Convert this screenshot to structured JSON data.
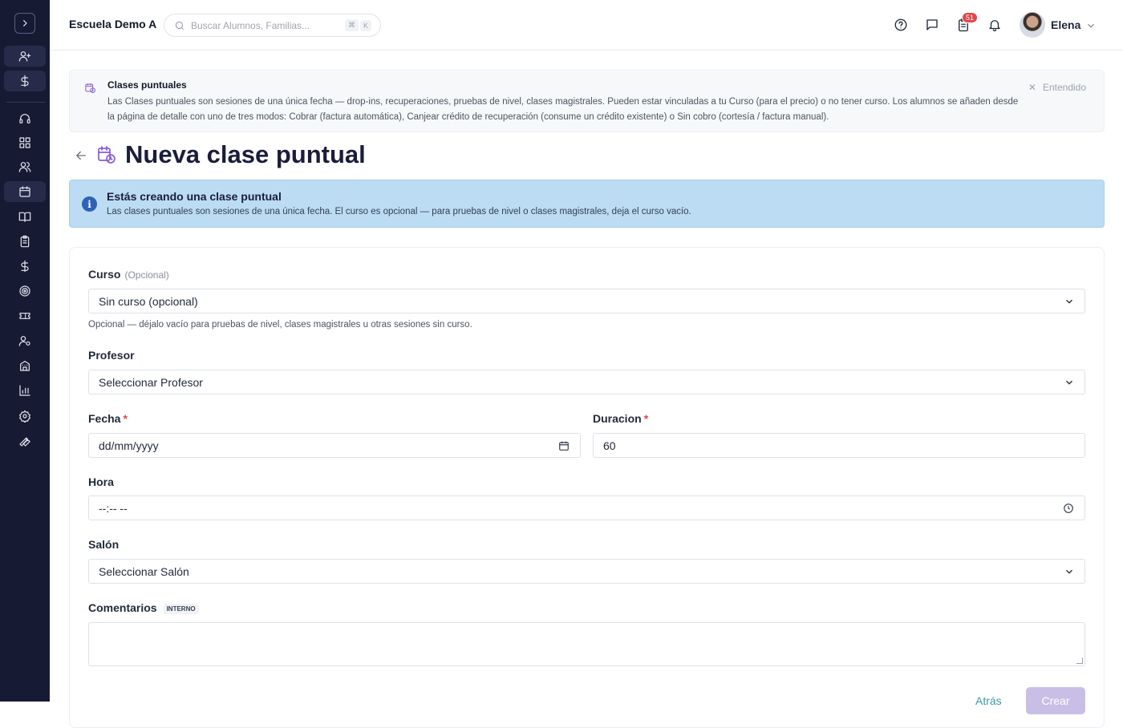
{
  "header": {
    "school_name": "Escuela Demo A",
    "search_placeholder": "Buscar Alumnos, Familias...",
    "search_shortcut": [
      "⌘",
      "K"
    ],
    "tasks_badge": "51",
    "user_name": "Elena"
  },
  "sidebar": {
    "items": [
      "add-user",
      "dollar",
      "headset",
      "dashboard",
      "users",
      "calendar",
      "book",
      "clipboard",
      "dollar-2",
      "target",
      "ticket",
      "user-settings",
      "building",
      "chart",
      "gear",
      "wrench"
    ],
    "active": "calendar"
  },
  "notice": {
    "title": "Clases puntuales",
    "body": "Las Clases puntuales son sesiones de una única fecha — drop-ins, recuperaciones, pruebas de nivel, clases magistrales. Pueden estar vinculadas a tu Curso (para el precio) o no tener curso. Los alumnos se añaden desde la página de detalle con uno de tres modos: Cobrar (factura automática), Canjear crédito de recuperación (consume un crédito existente) o Sin cobro (cortesía / factura manual).",
    "dismiss_label": "Entendido"
  },
  "page": {
    "title": "Nueva clase puntual"
  },
  "info": {
    "title": "Estás creando una clase puntual",
    "body": "Las clases puntuales son sesiones de una única fecha. El curso es opcional — para pruebas de nivel o clases magistrales, deja el curso vacío."
  },
  "form": {
    "curso_label": "Curso",
    "curso_optional": "(Opcional)",
    "curso_value": "Sin curso (opcional)",
    "curso_help": "Opcional — déjalo vacío para pruebas de nivel, clases magistrales u otras sesiones sin curso.",
    "profesor_label": "Profesor",
    "profesor_value": "Seleccionar Profesor",
    "fecha_label": "Fecha",
    "fecha_value": "dd/mm/yyyy",
    "duracion_label": "Duracion",
    "duracion_value": "60",
    "required_mark": "*",
    "hora_label": "Hora",
    "hora_value": "--:-- --",
    "salon_label": "Salón",
    "salon_value": "Seleccionar Salón",
    "comentarios_label": "Comentarios",
    "comentarios_tag": "INTERNO",
    "comentarios_value": "",
    "back_label": "Atrás",
    "create_label": "Crear"
  },
  "colors": {
    "sidebar_bg": "#161a33",
    "accent_purple": "#8a5cd6",
    "info_bg": "#bcdcf3",
    "required": "#e04848",
    "link_teal": "#3b9aa8"
  }
}
